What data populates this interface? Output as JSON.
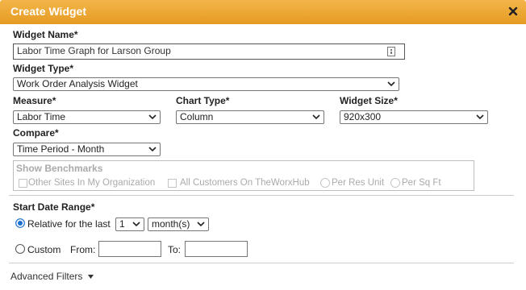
{
  "dialog": {
    "title": "Create Widget",
    "close_icon": "close-x-icon"
  },
  "widget_name": {
    "label": "Widget Name*",
    "value": "Labor Time Graph for Larson Group"
  },
  "widget_type": {
    "label": "Widget Type*",
    "selected": "Work Order Analysis Widget"
  },
  "measure": {
    "label": "Measure*",
    "selected": "Labor Time"
  },
  "chart_type": {
    "label": "Chart Type*",
    "selected": "Column"
  },
  "widget_size": {
    "label": "Widget Size*",
    "selected": "920x300"
  },
  "compare": {
    "label": "Compare*",
    "selected": "Time Period - Month"
  },
  "benchmarks": {
    "label": "Show Benchmarks",
    "options": {
      "other_sites": "Other Sites In My Organization",
      "all_customers": "All Customers On TheWorxHub",
      "per_res_unit": "Per Res Unit",
      "per_sq_ft": "Per Sq Ft"
    }
  },
  "start_date_range": {
    "label": "Start Date Range*",
    "relative_label": "Relative for the last",
    "relative_count": "1",
    "relative_unit": "month(s)",
    "custom_label": "Custom",
    "from_label": "From:",
    "to_label": "To:"
  },
  "advanced_filters": {
    "label": "Advanced Filters"
  }
}
